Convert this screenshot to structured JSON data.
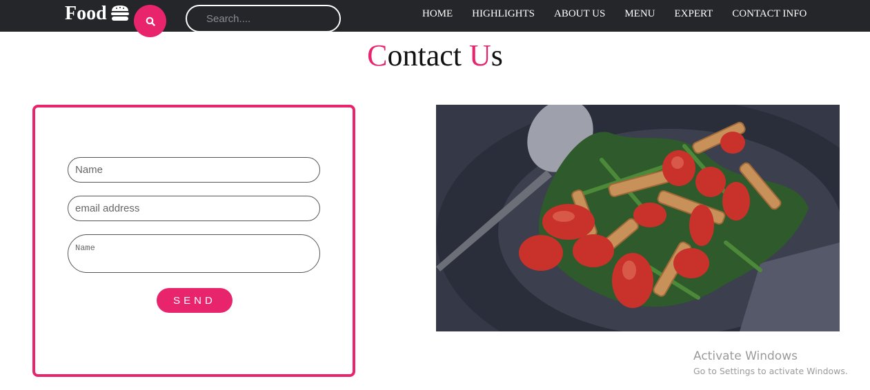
{
  "header": {
    "brand": "Food",
    "brand_icon": "burger-icon",
    "search_icon": "search-icon",
    "search_placeholder": "Search....",
    "nav": [
      {
        "label": "HOME"
      },
      {
        "label": "HIGHLIGHTS"
      },
      {
        "label": "ABOUT US"
      },
      {
        "label": "MENU"
      },
      {
        "label": "EXPERT"
      },
      {
        "label": "CONTACT INFO"
      }
    ]
  },
  "main": {
    "title_first_letter": "C",
    "title_rest_first": "ontact ",
    "title_second_letter": "U",
    "title_rest_second": "s"
  },
  "form": {
    "name_placeholder": "Name",
    "email_placeholder": "email address",
    "message_placeholder": "Name",
    "send_label": "SEND"
  },
  "watermark": {
    "title": "Activate Windows",
    "subtitle": "Go to Settings to activate Windows."
  },
  "colors": {
    "accent": "#e8246c",
    "navbar": "#25262a",
    "text": "#111111"
  }
}
